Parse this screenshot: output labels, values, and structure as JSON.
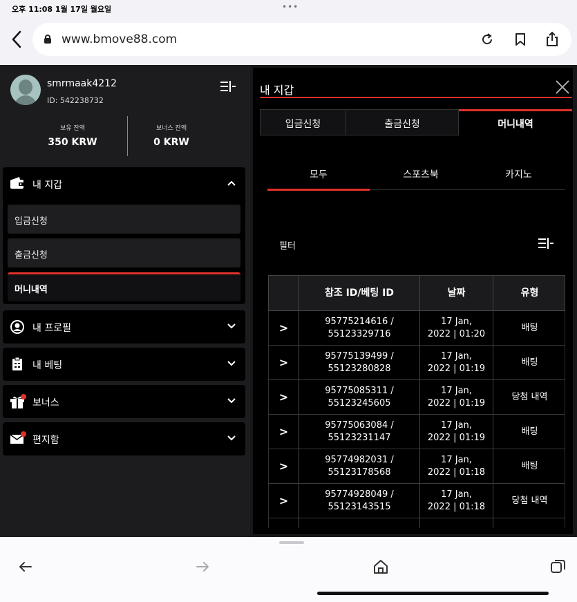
{
  "status_bar": {
    "time": "오후 11:08   1월 17일 월요일",
    "dots": "•••"
  },
  "browser": {
    "url": "www.bmove88.com",
    "icons": [
      "back-chevron-icon",
      "lock-icon",
      "reload-icon",
      "bookmark-icon",
      "share-icon"
    ]
  },
  "profile": {
    "username": "smrmaak4212",
    "user_id": "ID: 542238732",
    "balance_label": "보유 잔액",
    "balance_value": "350 KRW",
    "bonus_label": "보너스 잔액",
    "bonus_value": "0 KRW"
  },
  "sidebar": {
    "wallet": {
      "label": "내 지갑",
      "items": [
        {
          "label": "입금신청"
        },
        {
          "label": "출금신청"
        },
        {
          "label": "머니내역",
          "active": true
        }
      ]
    },
    "profile_menu": {
      "label": "내 프로필"
    },
    "bets_menu": {
      "label": "내 베팅"
    },
    "bonus_menu": {
      "label": "보너스"
    },
    "inbox_menu": {
      "label": "편지함"
    }
  },
  "panel": {
    "title": "내 지갑",
    "tabs": [
      {
        "label": "입금신청"
      },
      {
        "label": "출금신청"
      },
      {
        "label": "머니내역",
        "active": true
      }
    ],
    "subtabs": [
      {
        "label": "모두",
        "active": true
      },
      {
        "label": "스포츠북"
      },
      {
        "label": "카지노"
      }
    ],
    "filter_label": "필터",
    "table": {
      "headers": [
        "",
        "참조 ID/베팅 ID",
        "날짜",
        "유형"
      ],
      "rows": [
        {
          "ref": "95775214616 /",
          "bet": "55123329716",
          "date": "17 Jan,",
          "time": "2022 | 01:20",
          "type": "배팅"
        },
        {
          "ref": "95775139499 /",
          "bet": "55123280828",
          "date": "17 Jan,",
          "time": "2022 | 01:19",
          "type": "배팅"
        },
        {
          "ref": "95775085311 /",
          "bet": "55123245605",
          "date": "17 Jan,",
          "time": "2022 | 01:19",
          "type": "당첨 내역"
        },
        {
          "ref": "95775063084 /",
          "bet": "55123231147",
          "date": "17 Jan,",
          "time": "2022 | 01:19",
          "type": "배팅"
        },
        {
          "ref": "95774982031 /",
          "bet": "55123178568",
          "date": "17 Jan,",
          "time": "2022 | 01:18",
          "type": "배팅"
        },
        {
          "ref": "95774928049 /",
          "bet": "55123143515",
          "date": "17 Jan,",
          "time": "2022 | 01:18",
          "type": "당첨 내역"
        }
      ]
    }
  },
  "colors": {
    "accent": "#e0312b",
    "panel_bg": "#000000",
    "sidebar_bg": "#1c1c1f",
    "chrome_bg": "#f2f2f7"
  }
}
